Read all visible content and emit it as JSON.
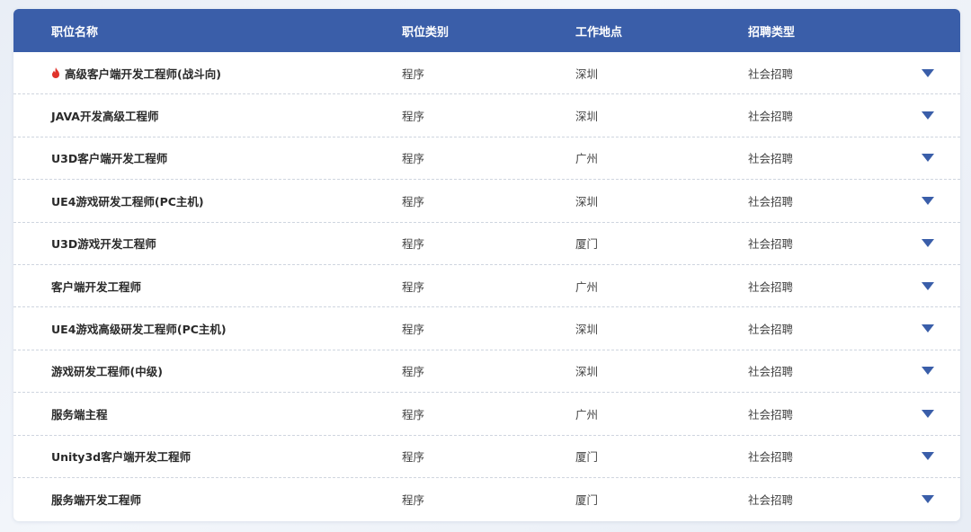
{
  "table": {
    "headers": {
      "name": "职位名称",
      "category": "职位类别",
      "location": "工作地点",
      "type": "招聘类型"
    },
    "rows": [
      {
        "name": "高级客户端开发工程师(战斗向)",
        "category": "程序",
        "location": "深圳",
        "type": "社会招聘",
        "hot": true
      },
      {
        "name": "JAVA开发高级工程师",
        "category": "程序",
        "location": "深圳",
        "type": "社会招聘",
        "hot": false
      },
      {
        "name": "U3D客户端开发工程师",
        "category": "程序",
        "location": "广州",
        "type": "社会招聘",
        "hot": false
      },
      {
        "name": "UE4游戏研发工程师(PC主机)",
        "category": "程序",
        "location": "深圳",
        "type": "社会招聘",
        "hot": false
      },
      {
        "name": "U3D游戏开发工程师",
        "category": "程序",
        "location": "厦门",
        "type": "社会招聘",
        "hot": false
      },
      {
        "name": "客户端开发工程师",
        "category": "程序",
        "location": "广州",
        "type": "社会招聘",
        "hot": false
      },
      {
        "name": "UE4游戏高级研发工程师(PC主机)",
        "category": "程序",
        "location": "深圳",
        "type": "社会招聘",
        "hot": false
      },
      {
        "name": "游戏研发工程师(中级)",
        "category": "程序",
        "location": "深圳",
        "type": "社会招聘",
        "hot": false
      },
      {
        "name": "服务端主程",
        "category": "程序",
        "location": "广州",
        "type": "社会招聘",
        "hot": false
      },
      {
        "name": "Unity3d客户端开发工程师",
        "category": "程序",
        "location": "厦门",
        "type": "社会招聘",
        "hot": false
      },
      {
        "name": "服务端开发工程师",
        "category": "程序",
        "location": "厦门",
        "type": "社会招聘",
        "hot": false
      }
    ]
  },
  "colors": {
    "header_bg": "#3a5ea9",
    "arrow": "#3a5ea9",
    "hot": "#e0332b"
  },
  "icons": {
    "expand": "triangle-down-icon",
    "hot": "fire-icon"
  }
}
